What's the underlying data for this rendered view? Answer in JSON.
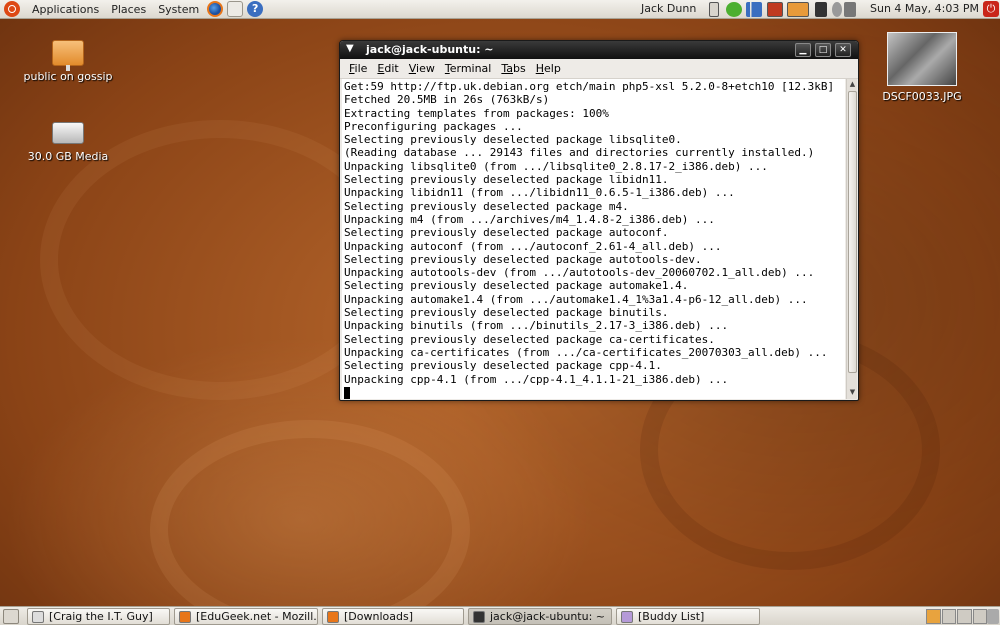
{
  "top_panel": {
    "menus": [
      "Applications",
      "Places",
      "System"
    ],
    "user": "Jack Dunn",
    "clock": "Sun  4 May,  4:03 PM"
  },
  "desktop": {
    "icons": [
      {
        "label": "public on gossip"
      },
      {
        "label": "30.0 GB Media"
      },
      {
        "label": "DSCF0033.JPG"
      }
    ]
  },
  "terminal": {
    "title": "jack@jack-ubuntu: ~",
    "menu": [
      {
        "first": "F",
        "rest": "ile"
      },
      {
        "first": "E",
        "rest": "dit"
      },
      {
        "first": "V",
        "rest": "iew"
      },
      {
        "first": "T",
        "rest": "erminal"
      },
      {
        "first": "Ta",
        "rest": "bs"
      },
      {
        "first": "H",
        "rest": "elp"
      }
    ],
    "lines": [
      "Get:59 http://ftp.uk.debian.org etch/main php5-xsl 5.2.0-8+etch10 [12.3kB]",
      "Fetched 20.5MB in 26s (763kB/s)",
      "Extracting templates from packages: 100%",
      "Preconfiguring packages ...",
      "Selecting previously deselected package libsqlite0.",
      "(Reading database ... 29143 files and directories currently installed.)",
      "Unpacking libsqlite0 (from .../libsqlite0_2.8.17-2_i386.deb) ...",
      "Selecting previously deselected package libidn11.",
      "Unpacking libidn11 (from .../libidn11_0.6.5-1_i386.deb) ...",
      "Selecting previously deselected package m4.",
      "Unpacking m4 (from .../archives/m4_1.4.8-2_i386.deb) ...",
      "Selecting previously deselected package autoconf.",
      "Unpacking autoconf (from .../autoconf_2.61-4_all.deb) ...",
      "Selecting previously deselected package autotools-dev.",
      "Unpacking autotools-dev (from .../autotools-dev_20060702.1_all.deb) ...",
      "Selecting previously deselected package automake1.4.",
      "Unpacking automake1.4 (from .../automake1.4_1%3a1.4-p6-12_all.deb) ...",
      "Selecting previously deselected package binutils.",
      "Unpacking binutils (from .../binutils_2.17-3_i386.deb) ...",
      "Selecting previously deselected package ca-certificates.",
      "Unpacking ca-certificates (from .../ca-certificates_20070303_all.deb) ...",
      "Selecting previously deselected package cpp-4.1.",
      "Unpacking cpp-4.1 (from .../cpp-4.1_4.1.1-21_i386.deb) ..."
    ]
  },
  "taskbar": {
    "tasks": [
      {
        "label": "[Craig the I.T. Guy]",
        "icon": "window-icon",
        "active": false
      },
      {
        "label": "[EduGeek.net - Mozill...",
        "icon": "firefox-icon",
        "active": false
      },
      {
        "label": "[Downloads]",
        "icon": "firefox-icon",
        "active": false
      },
      {
        "label": "jack@jack-ubuntu: ~",
        "icon": "terminal-icon",
        "active": true
      },
      {
        "label": "[Buddy List]",
        "icon": "pidgin-icon",
        "active": false
      }
    ]
  },
  "colors": {
    "desktop": "#a4541f",
    "panel": "#e6e2da",
    "workspace_active": "#e8a33e"
  }
}
